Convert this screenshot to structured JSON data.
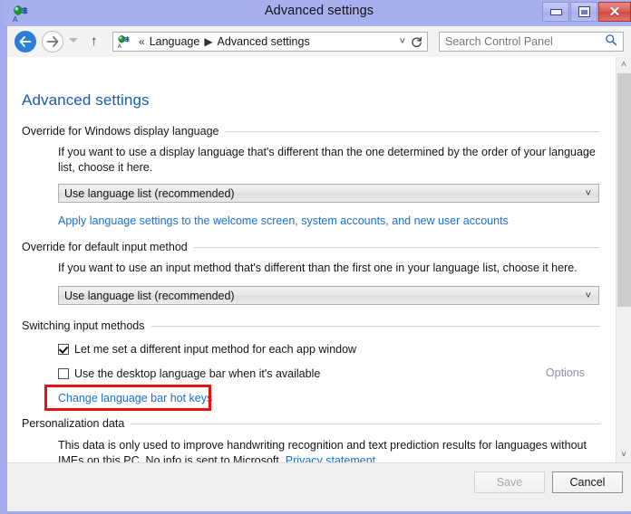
{
  "window": {
    "title": "Advanced settings",
    "icon": "language-globe-icon",
    "controls": {
      "minimize": "minimize-button",
      "maximize": "maximize-button",
      "close": "close-button"
    }
  },
  "nav": {
    "back": "back-button",
    "forward": "forward-button",
    "recent_dropdown": "recent-pages-chevron",
    "up": "up-one-level-button",
    "refresh": "refresh-button",
    "breadcrumb": {
      "overflow": "«",
      "separator": "▶",
      "items": [
        "Language",
        "Advanced settings"
      ]
    }
  },
  "search": {
    "placeholder": "Search Control Panel",
    "value": "",
    "icon": "search-icon"
  },
  "page": {
    "title": "Advanced settings"
  },
  "sections": [
    {
      "label": "Override for Windows display language",
      "description": "If you want to use a display language that's different than the one determined by the order of your language list, choose it here.",
      "combo_value": "Use language list (recommended)",
      "link": "Apply language settings to the welcome screen, system accounts, and new user accounts"
    },
    {
      "label": "Override for default input method",
      "description": "If you want to use an input method that's different than the first one in your language list, choose it here.",
      "combo_value": "Use language list (recommended)"
    },
    {
      "label": "Switching input methods",
      "checkbox1": {
        "label": "Let me set a different input method for each app window",
        "checked": true
      },
      "checkbox2": {
        "label": "Use the desktop language bar when it's available",
        "checked": false
      },
      "options_link": "Options",
      "hotkeys_link": "Change language bar hot keys"
    },
    {
      "label": "Personalization data",
      "description": "This data is only used to improve handwriting recognition and text prediction results for languages without IMEs on this PC. No info is sent to Microsoft.",
      "privacy_link": "Privacy statement"
    }
  ],
  "footer": {
    "save_label": "Save",
    "cancel_label": "Cancel"
  },
  "highlight": {
    "color": "#e81212",
    "target": "Change language bar hot keys"
  },
  "scrollbar": {
    "up_arrow": "˄",
    "down_arrow": "˅"
  },
  "glyphs": {
    "chevron_down": "˅",
    "overflow": "«",
    "separator": "▶",
    "up_arrow": "↑",
    "close_x": "✕"
  }
}
